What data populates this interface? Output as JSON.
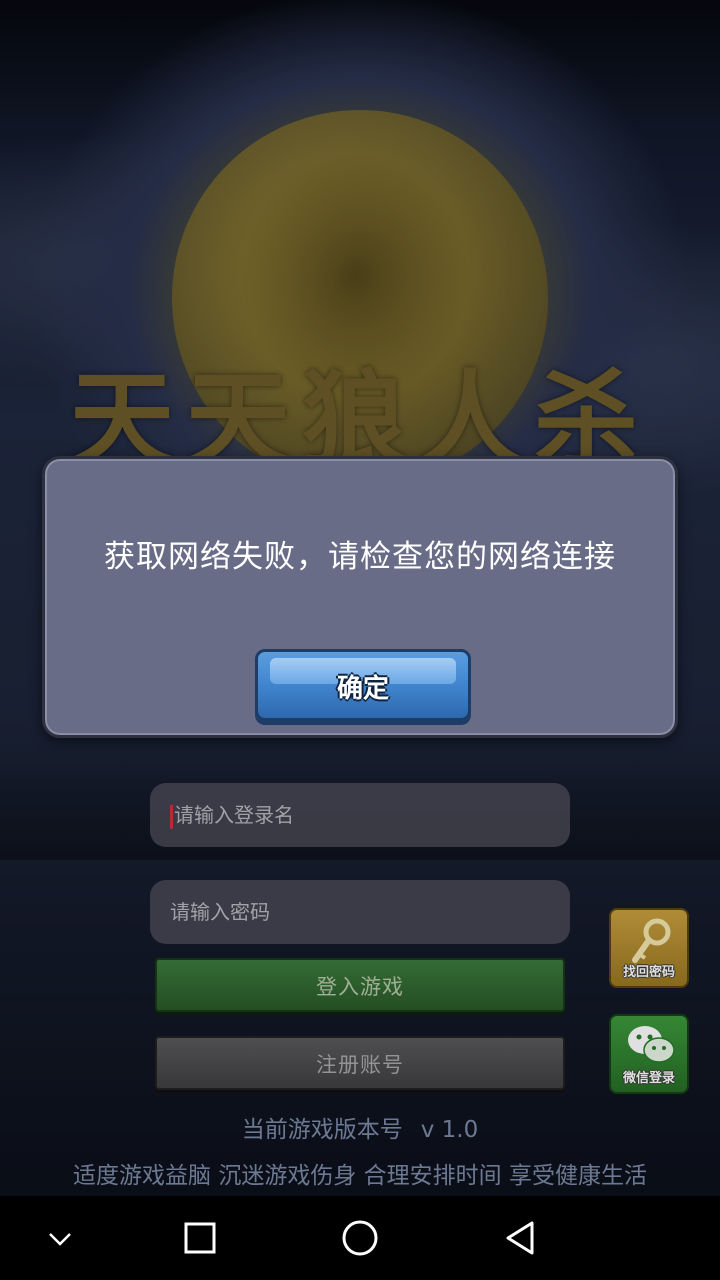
{
  "background": {
    "game_logo": "天天狼人杀"
  },
  "dialog": {
    "message": "获取网络失败，请检查您的网络连接",
    "ok_label": "确定"
  },
  "login": {
    "username_placeholder": "请输入登录名",
    "password_placeholder": "请输入密码",
    "login_label": "登入游戏",
    "register_label": "注册账号",
    "recover_label": "找回密码",
    "wechat_label": "微信登录"
  },
  "footer": {
    "version_prefix": "当前游戏版本号",
    "version_value": "v 1.0",
    "advice": "适度游戏益脑 沉迷游戏伤身 合理安排时间 享受健康生活"
  },
  "navbar": {
    "icons": [
      "chevron-down-icon",
      "recents-icon",
      "home-icon",
      "back-icon"
    ]
  },
  "colors": {
    "dialog_bg": "#686c86",
    "ok_button": "#3f82cc",
    "login_button": "#3c7a3c",
    "register_button": "#4a4a4c",
    "recover_button": "#c8a040",
    "wechat_button": "#3d9a3d",
    "footer_text": "#7c8aa8"
  }
}
